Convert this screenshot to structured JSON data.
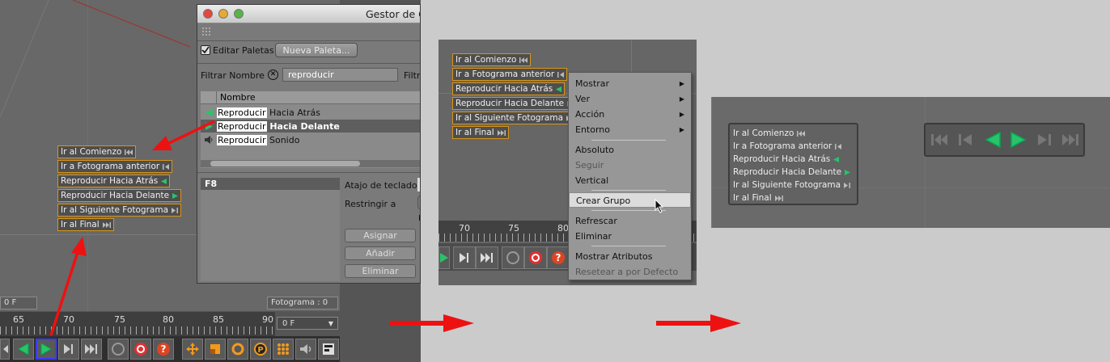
{
  "panel1": {
    "commands": [
      "Ir al Comienzo",
      "Ir a Fotograma anterior",
      "Reproducir Hacia Atrás",
      "Reproducir Hacia Delante",
      "Ir al Siguiente Fotograma",
      "Ir al Final"
    ],
    "frame_left": "0 F",
    "frame_right": "Fotograma : 0",
    "ruler_ticks": [
      "65",
      "70",
      "75",
      "80",
      "85",
      "90"
    ],
    "frame_dropdown": "0 F"
  },
  "dialog": {
    "title": "Gestor de C",
    "edit_palettes": "Editar Paletas",
    "new_palette": "Nueva Paleta...",
    "filter_label": "Filtrar Nombre",
    "filter_value": "reproducir",
    "filter_label2": "Filtra",
    "column_name": "Nombre",
    "rows": [
      {
        "match": "Reproducir",
        "rest": " Hacia Atrás"
      },
      {
        "match": "Reproducir",
        "rest": " Hacia Delante"
      },
      {
        "match": "Reproducir",
        "rest": " Sonido"
      }
    ],
    "shortcut_key": "F8",
    "shortcut_label": "Atajo de teclado",
    "restrict_label": "Restringir a",
    "restrict_small": "I",
    "assign": "Asignar",
    "add": "Añadir",
    "delete": "Eliminar"
  },
  "panel2": {
    "commands": [
      "Ir al Comienzo",
      "Ir a Fotograma anterior",
      "Reproducir Hacia Atrás",
      "Reproducir Hacia Delante",
      "Ir al Siguiente Fotograma",
      "Ir al Final"
    ],
    "ruler_ticks": [
      "70",
      "75",
      "80"
    ]
  },
  "context_menu": {
    "items": [
      "Mostrar",
      "Ver",
      "Acción",
      "Entorno",
      "Absoluto",
      "Seguir",
      "Vertical",
      "Crear Grupo",
      "Refrescar",
      "Eliminar",
      "Mostrar Atributos",
      "Resetear a por Defecto"
    ]
  },
  "panel3": {
    "commands": [
      "Ir al Comienzo",
      "Ir a Fotograma anterior",
      "Reproducir Hacia Atrás",
      "Reproducir Hacia Delante",
      "Ir al Siguiente Fotograma",
      "Ir al Final"
    ]
  },
  "colors": {
    "arrow": "#ee1111",
    "highlight_border": "#d8941a",
    "play_green": "#29c36a"
  }
}
